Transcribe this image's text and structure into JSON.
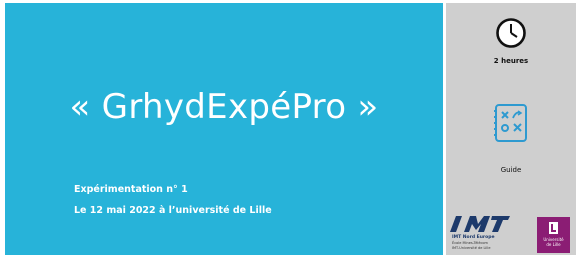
{
  "slide": {
    "title": "« GrhydExpéPro »",
    "subtitle_line1": "Expérimentation n° 1",
    "subtitle_line2": "Le  12 mai 2022 à l’université de Lille"
  },
  "side": {
    "duration_icon": "clock-icon",
    "duration_label": "2 heures",
    "guide_icon": "tactics-board-icon",
    "guide_label": "Guide"
  },
  "logos": {
    "imt_name": "IMT Nord Europe",
    "imt_line2": "École Mines-Télécom",
    "imt_line3": "IMT-Université de Lille",
    "lille_line1": "Université",
    "lille_line2": "de Lille"
  },
  "colors": {
    "main_panel": "#27b3d9",
    "side_panel": "#cfcfcf",
    "lille_brand": "#8b1d74",
    "imt_brand": "#1d3a6b"
  }
}
